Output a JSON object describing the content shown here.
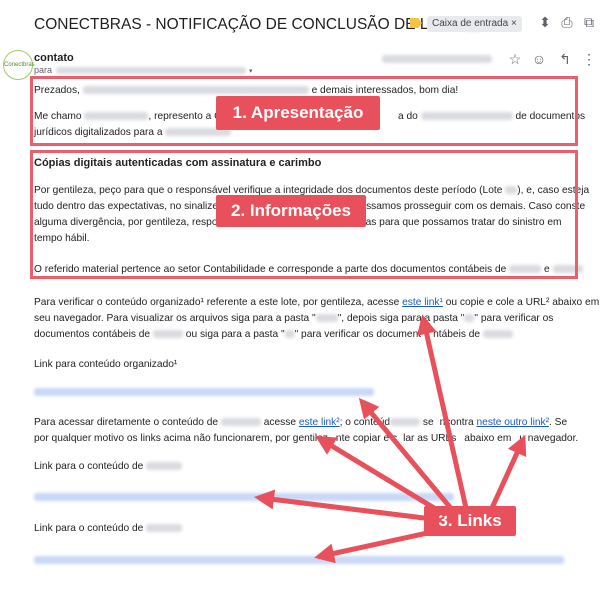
{
  "header": {
    "subject": "CONECTBRAS - NOTIFICAÇÃO DE CONCLUSÃO DE LOTE",
    "folder_label": "Caixa de entrada",
    "folder_close": "×",
    "icons": {
      "expand": "⬍",
      "print": "⎙",
      "external": "⧉"
    }
  },
  "sender": {
    "avatar_text": "Conectbras",
    "name": "contato",
    "to_prefix": "para",
    "caret": "▾"
  },
  "actions": {
    "star": "☆",
    "emoji": "☺",
    "reply": "↰",
    "more": "⋮"
  },
  "email": {
    "greeting_start": "Prezados,",
    "greeting_end": "e demais interessados, bom dia!",
    "intro_me": "Me chamo",
    "intro_represent": ", represento a Co",
    "intro_do": "a do",
    "intro_docs": "de documentos",
    "intro_line2": "jurídicos digitalizados para a",
    "section_title": "Cópias digitais autenticadas com assinatura e carimbo",
    "info_line1a": "Por gentileza, peço para que o responsável verifique a integridade dos documentos deste período (Lote",
    "info_line1b": "), e, caso esteja",
    "info_line2a": "tudo dentro das expectativas, no sinalize",
    "info_line2b": "ssamos prosseguir com os demais. Caso conste",
    "info_line3a": "alguma divergência, por gentileza, respor",
    "info_line3b": "ências para que possamos tratar do sinistro em",
    "info_line4": "tempo hábil.",
    "info_line5a": "O referido material pertence ao setor Contabilidade e corresponde a parte dos documentos contábeis de",
    "info_line5b": "e",
    "links_p1a": "Para verificar o conteúdo organizado¹ referente a este lote, por gentileza, acesse",
    "links_p1_link": "este link¹",
    "links_p1b": "ou copie e cole a URL² abaixo em",
    "links_p2": "seu navegador. Para visualizar os arquivos siga para a pasta \"",
    "links_p2b": "\", depois siga para a pasta \"",
    "links_p2c": "\" para verificar os",
    "links_p3a": "documentos contábeis de",
    "links_p3b": "ou siga para a pasta \"",
    "links_p3c": "\" para verificar os document",
    "links_p3d": "ntábeis de",
    "organized_label": "Link para conteúdo organizado¹",
    "direct_a": "Para acessar diretamente o conteúdo de",
    "direct_b": "acesse",
    "direct_link1": "este link²",
    "direct_c": "; o conteúd",
    "direct_d": "se",
    "direct_e": "ncontra",
    "direct_link2": "neste outro link²",
    "direct_f": ". Se",
    "direct_line2a": "por qualquer motivo os links acima não funcionarem, por gentilez",
    "direct_line2b": "nte copiar e c",
    "direct_line2c": "lar as URLs",
    "direct_line2d": "abaixo em",
    "direct_line2e": "u navegador.",
    "content_label_1": "Link para o conteúdo de",
    "content_label_2": "Link para o conteúdo de"
  },
  "annotations": {
    "label_1": "1. Apresentação",
    "label_2": "2. Informações",
    "label_3": "3. Links",
    "color": "#e8505b"
  }
}
